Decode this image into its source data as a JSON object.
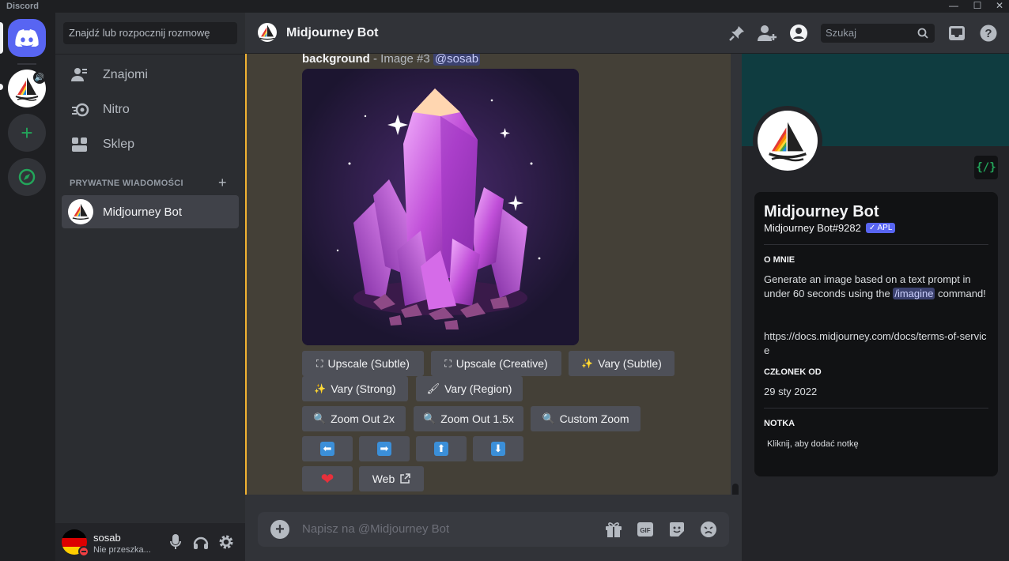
{
  "window": {
    "app_name": "Discord"
  },
  "sidebar": {
    "search_placeholder": "Znajdź lub rozpocznij rozmowę",
    "nav": [
      {
        "label": "Znajomi",
        "icon": "friends-icon"
      },
      {
        "label": "Nitro",
        "icon": "nitro-icon"
      },
      {
        "label": "Sklep",
        "icon": "shop-icon"
      }
    ],
    "dm_section_title": "PRYWATNE WIADOMOŚCI",
    "dm_add": "+",
    "dms": [
      {
        "label": "Midjourney Bot"
      }
    ]
  },
  "user": {
    "name": "sosab",
    "status": "Nie przeszka..."
  },
  "header": {
    "title": "Midjourney Bot",
    "search_placeholder": "Szukaj"
  },
  "message": {
    "prompt_end": "background",
    "image_info": " - Image #3 ",
    "mention": "@sosab"
  },
  "buttons": {
    "upscale_subtle": "Upscale (Subtle)",
    "upscale_creative": "Upscale (Creative)",
    "vary_subtle": "Vary (Subtle)",
    "vary_strong": "Vary (Strong)",
    "vary_region": "Vary (Region)",
    "zoom_out_2x": "Zoom Out 2x",
    "zoom_out_15x": "Zoom Out 1.5x",
    "custom_zoom": "Custom Zoom",
    "web": "Web"
  },
  "composer": {
    "placeholder": "Napisz na @Midjourney Bot"
  },
  "profile": {
    "name": "Midjourney Bot",
    "tag": "Midjourney Bot#9282",
    "app_badge": "APL",
    "dev_badge": "{/}",
    "about_label": "O MNIE",
    "about_text_1": "Generate an image based on a text prompt in under 60 seconds using the ",
    "about_cmd": "/imagine",
    "about_text_2": " command!",
    "about_link": "https://docs.midjourney.com/docs/terms-of-service",
    "member_label": "CZŁONEK OD",
    "member_since": "29 sty 2022",
    "note_label": "NOTKA",
    "note_placeholder": "Kliknij, aby dodać notkę"
  },
  "colors": {
    "accent": "#5865f2",
    "highlight_bar": "#f0b232",
    "banner": "#0f3c40",
    "link": "#00a8fc",
    "online": "#23a55a",
    "dnd": "#f23f43"
  }
}
